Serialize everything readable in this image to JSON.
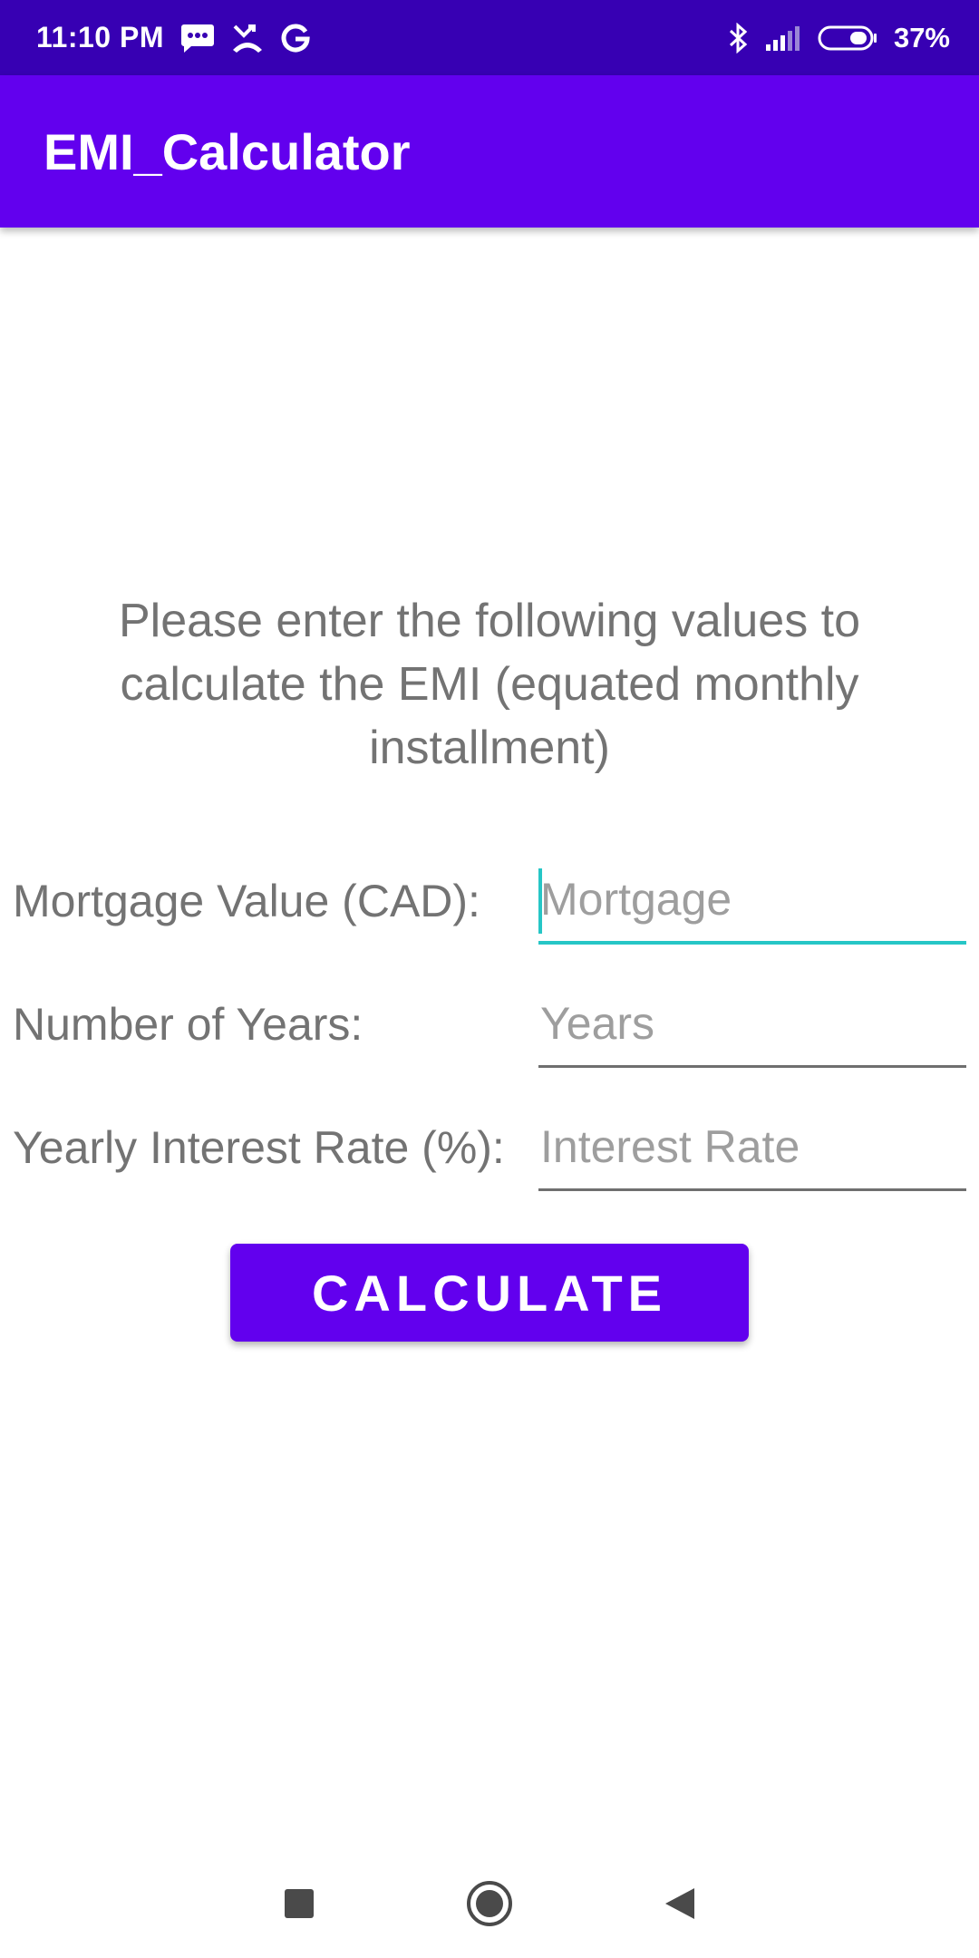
{
  "status_bar": {
    "time": "11:10 PM",
    "battery_percent": "37%",
    "icons": [
      "message-icon",
      "missed-call-icon",
      "google-icon",
      "bluetooth-icon",
      "signal-icon",
      "battery-icon"
    ]
  },
  "app_bar": {
    "title": "EMI_Calculator"
  },
  "form": {
    "instructions": "Please enter the following values to calculate the EMI (equated monthly installment)",
    "mortgage": {
      "label": "Mortgage Value (CAD):",
      "value": "",
      "placeholder": "Mortgage"
    },
    "years": {
      "label": "Number of Years:",
      "value": "",
      "placeholder": "Years"
    },
    "interest": {
      "label": "Yearly Interest Rate (%):",
      "value": "",
      "placeholder": "Interest Rate"
    },
    "calculate_label": "CALCULATE"
  },
  "nav_bar": {
    "icons": [
      "recents-square-icon",
      "home-circle-icon",
      "back-triangle-icon"
    ]
  },
  "colors": {
    "status_bar": "#3700b3",
    "primary": "#6200ee",
    "accent": "#26c6c6",
    "label_text": "#737373",
    "placeholder_text": "#9e9e9e"
  }
}
